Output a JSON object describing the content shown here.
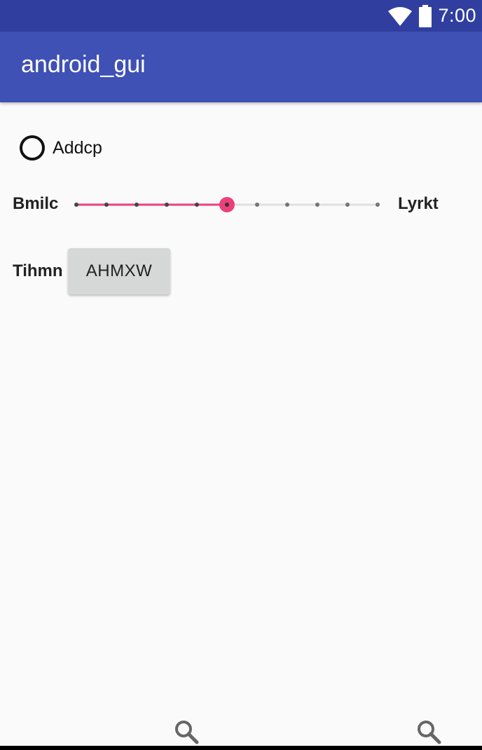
{
  "status_bar": {
    "time": "7:00",
    "icons": [
      "wifi-icon",
      "battery-icon"
    ]
  },
  "app_bar": {
    "title": "android_gui"
  },
  "radio": {
    "label": "Addcp",
    "checked": false
  },
  "slider": {
    "left_label": "Bmilc",
    "right_label": "Lyrkt",
    "min": 0,
    "max": 10,
    "value": 5,
    "steps": 10
  },
  "button_row": {
    "label": "Tihmn",
    "button_text": "AHMXW"
  },
  "bottom_icons": [
    "search-icon",
    "search-icon"
  ],
  "colors": {
    "status_bar": "#303f9f",
    "app_bar": "#3f51b5",
    "accent": "#ec407a",
    "background": "#fafafa"
  }
}
